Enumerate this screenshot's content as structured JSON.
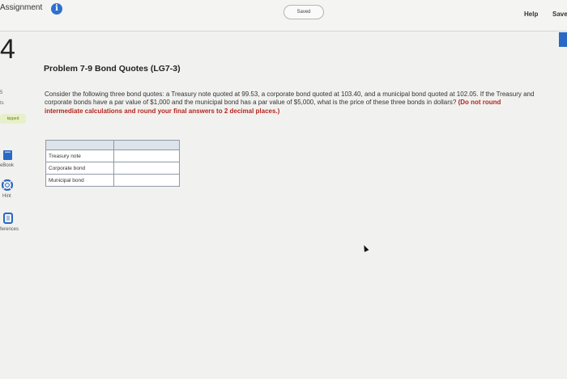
{
  "header": {
    "assignment_title": "Assignment",
    "saved_label": "Saved",
    "help_label": "Help",
    "save_label": "Save"
  },
  "sidebar": {
    "question_number": "4",
    "prev_number": "5",
    "points_suffix": "ts",
    "skipped_badge": "kipped",
    "tools": [
      {
        "label": "eBook",
        "icon": "book-icon"
      },
      {
        "label": "Hint",
        "icon": "lifebuoy-icon"
      },
      {
        "label": "ferences",
        "icon": "references-icon"
      }
    ]
  },
  "problem": {
    "title": "Problem 7-9 Bond Quotes (LG7-3)",
    "body": "Consider the following three bond quotes: a Treasury note quoted at 99.53, a corporate bond quoted at 103.40, and a municipal bond quoted at 102.05. If the Treasury and corporate bonds have a par value of $1,000 and the municipal bond has a par value of $5,000, what is the price of these three bonds in dollars? ",
    "instruction": "(Do not round intermediate calculations and round your final answers to 2 decimal places.)"
  },
  "table": {
    "rows": [
      {
        "label": "Treasury note",
        "value": ""
      },
      {
        "label": "Corporate bond",
        "value": ""
      },
      {
        "label": "Municipal bond",
        "value": ""
      }
    ]
  },
  "colors": {
    "accent": "#2a68c5",
    "instruction_red": "#b3261e",
    "skipped_green": "#5e7d16"
  }
}
